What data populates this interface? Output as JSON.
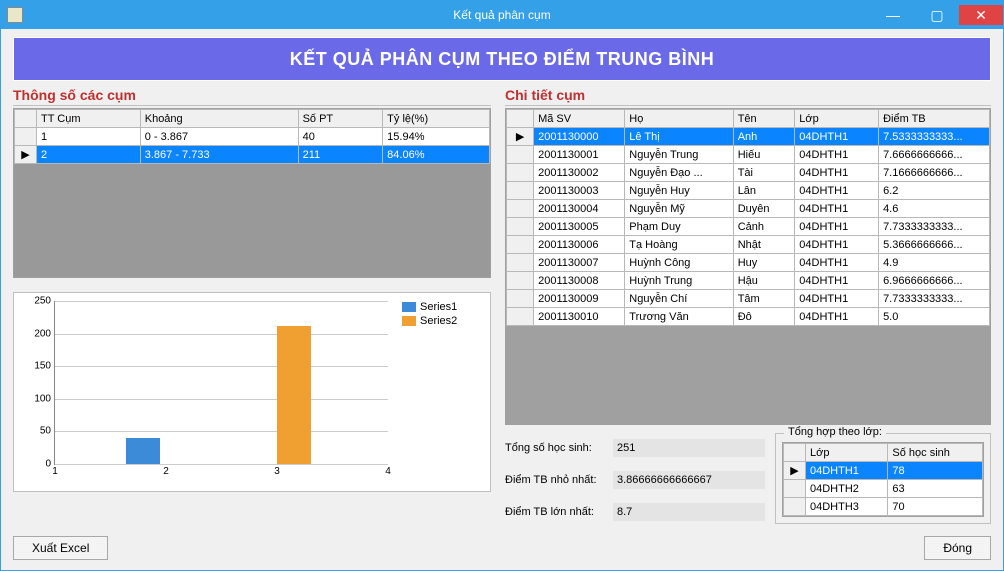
{
  "window": {
    "title": "Kết quả phân cụm"
  },
  "banner": "KẾT QUẢ PHÂN CỤM THEO ĐIỂM TRUNG BÌNH",
  "clusters": {
    "title": "Thông số các cụm",
    "headers": [
      "TT Cụm",
      "Khoảng",
      "Số PT",
      "Tỷ lệ(%)"
    ],
    "rows": [
      {
        "tt": "1",
        "khoang": "0 - 3.867",
        "sopt": "40",
        "tyle": "15.94%",
        "selected": false
      },
      {
        "tt": "2",
        "khoang": "3.867 - 7.733",
        "sopt": "211",
        "tyle": "84.06%",
        "selected": true
      }
    ]
  },
  "detail": {
    "title": "Chi tiết cụm",
    "headers": [
      "Mã SV",
      "Họ",
      "Tên",
      "Lớp",
      "Điểm TB"
    ],
    "rows": [
      {
        "masv": "2001130000",
        "ho": "Lê Thị",
        "ten": "Anh",
        "lop": "04DHTH1",
        "diem": "7.5333333333...",
        "selected": true
      },
      {
        "masv": "2001130001",
        "ho": "Nguyễn Trung",
        "ten": "Hiếu",
        "lop": "04DHTH1",
        "diem": "7.6666666666..."
      },
      {
        "masv": "2001130002",
        "ho": "Nguyễn Đạo ...",
        "ten": "Tài",
        "lop": "04DHTH1",
        "diem": "7.1666666666..."
      },
      {
        "masv": "2001130003",
        "ho": "Nguyễn Huy",
        "ten": "Lân",
        "lop": "04DHTH1",
        "diem": "6.2"
      },
      {
        "masv": "2001130004",
        "ho": "Nguyễn Mỹ",
        "ten": "Duyên",
        "lop": "04DHTH1",
        "diem": "4.6"
      },
      {
        "masv": "2001130005",
        "ho": "Phạm Duy",
        "ten": "Cảnh",
        "lop": "04DHTH1",
        "diem": "7.7333333333..."
      },
      {
        "masv": "2001130006",
        "ho": "Tạ Hoàng",
        "ten": "Nhật",
        "lop": "04DHTH1",
        "diem": "5.3666666666..."
      },
      {
        "masv": "2001130007",
        "ho": "Huỳnh Công",
        "ten": "Huy",
        "lop": "04DHTH1",
        "diem": "4.9"
      },
      {
        "masv": "2001130008",
        "ho": "Huỳnh Trung",
        "ten": "Hậu",
        "lop": "04DHTH1",
        "diem": "6.9666666666..."
      },
      {
        "masv": "2001130009",
        "ho": "Nguyễn Chí",
        "ten": "Tâm",
        "lop": "04DHTH1",
        "diem": "7.7333333333..."
      },
      {
        "masv": "2001130010",
        "ho": "Trương Văn",
        "ten": "Đô",
        "lop": "04DHTH1",
        "diem": "5.0"
      }
    ]
  },
  "summary": {
    "total_label": "Tổng số học sinh:",
    "total": "251",
    "min_label": "Điểm TB nhỏ nhất:",
    "min": "3.86666666666667",
    "max_label": "Điểm TB lớn nhất:",
    "max": "8.7"
  },
  "class_summary": {
    "title": "Tổng hợp theo lớp:",
    "headers": [
      "Lớp",
      "Số học sinh"
    ],
    "rows": [
      {
        "lop": "04DHTH1",
        "so": "78",
        "selected": true
      },
      {
        "lop": "04DHTH2",
        "so": "63"
      },
      {
        "lop": "04DHTH3",
        "so": "70"
      }
    ]
  },
  "buttons": {
    "export": "Xuất Excel",
    "close": "Đóng"
  },
  "chart_data": {
    "type": "bar",
    "categories": [
      "1",
      "2",
      "3",
      "4"
    ],
    "x_positions": [
      1,
      2,
      3,
      4
    ],
    "series": [
      {
        "name": "Series1",
        "values": [
          40
        ],
        "x": [
          2
        ],
        "color": "#3b8bd8"
      },
      {
        "name": "Series2",
        "values": [
          211
        ],
        "x": [
          3
        ],
        "color": "#f0a030"
      }
    ],
    "title": "",
    "xlabel": "",
    "ylabel": "",
    "ylim": [
      0,
      250
    ],
    "yticks": [
      0,
      50,
      100,
      150,
      200,
      250
    ],
    "xlim": [
      1,
      4
    ]
  },
  "icons": {
    "arrow": "▶"
  }
}
